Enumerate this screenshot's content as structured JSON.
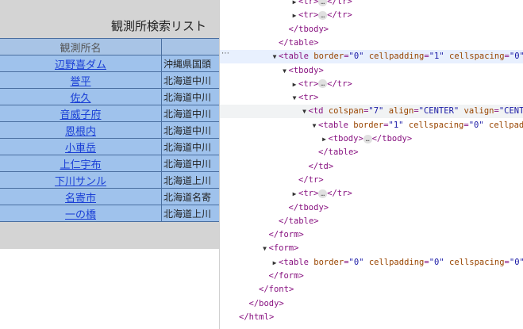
{
  "page": {
    "title": "観測所検索リスト",
    "table": {
      "header": [
        "観測所名",
        ""
      ],
      "rows": [
        {
          "name": "辺野喜ダム",
          "addr": "沖縄県国頭"
        },
        {
          "name": "誉平",
          "addr": "北海道中川"
        },
        {
          "name": "佐久",
          "addr": "北海道中川"
        },
        {
          "name": "音威子府",
          "addr": "北海道中川"
        },
        {
          "name": "恩根内",
          "addr": "北海道中川"
        },
        {
          "name": "小車岳",
          "addr": "北海道中川"
        },
        {
          "name": "上仁宇布",
          "addr": "北海道中川"
        },
        {
          "name": "下川サンル",
          "addr": "北海道上川"
        },
        {
          "name": "名寄市",
          "addr": "北海道名寄"
        },
        {
          "name": "一の橋",
          "addr": "北海道上川"
        }
      ]
    }
  },
  "devtools": {
    "more_icon": "⋯",
    "lines": [
      {
        "indent": 5,
        "toggle": "▶",
        "parts": [
          [
            "p",
            "<"
          ],
          [
            "t",
            "tr"
          ],
          [
            "p",
            ">"
          ],
          [
            "e",
            "…"
          ],
          [
            "p",
            "</"
          ],
          [
            "t",
            "tr"
          ],
          [
            "p",
            ">"
          ]
        ]
      },
      {
        "indent": 5,
        "toggle": "▶",
        "parts": [
          [
            "p",
            "<"
          ],
          [
            "t",
            "tr"
          ],
          [
            "p",
            ">"
          ],
          [
            "e",
            "…"
          ],
          [
            "p",
            "</"
          ],
          [
            "t",
            "tr"
          ],
          [
            "p",
            ">"
          ]
        ]
      },
      {
        "indent": 4,
        "toggle": "",
        "parts": [
          [
            "p",
            "</"
          ],
          [
            "t",
            "tbody"
          ],
          [
            "p",
            ">"
          ]
        ]
      },
      {
        "indent": 3,
        "toggle": "",
        "parts": [
          [
            "p",
            "</"
          ],
          [
            "t",
            "table"
          ],
          [
            "p",
            ">"
          ]
        ]
      },
      {
        "indent": 3,
        "toggle": "▼",
        "hl": true,
        "parts": [
          [
            "p",
            "<"
          ],
          [
            "t",
            "table"
          ],
          [
            "s",
            " "
          ],
          [
            "a",
            "border"
          ],
          [
            "p",
            "="
          ],
          [
            "v",
            "\"0\""
          ],
          [
            "s",
            " "
          ],
          [
            "a",
            "cellpadding"
          ],
          [
            "p",
            "="
          ],
          [
            "v",
            "\"1\""
          ],
          [
            "s",
            " "
          ],
          [
            "a",
            "cellspacing"
          ],
          [
            "p",
            "="
          ],
          [
            "v",
            "\"0\""
          ]
        ]
      },
      {
        "indent": 4,
        "toggle": "▼",
        "parts": [
          [
            "p",
            "<"
          ],
          [
            "t",
            "tbody"
          ],
          [
            "p",
            ">"
          ]
        ]
      },
      {
        "indent": 5,
        "toggle": "▶",
        "parts": [
          [
            "p",
            "<"
          ],
          [
            "t",
            "tr"
          ],
          [
            "p",
            ">"
          ],
          [
            "e",
            "…"
          ],
          [
            "p",
            "</"
          ],
          [
            "t",
            "tr"
          ],
          [
            "p",
            ">"
          ]
        ]
      },
      {
        "indent": 5,
        "toggle": "▼",
        "parts": [
          [
            "p",
            "<"
          ],
          [
            "t",
            "tr"
          ],
          [
            "p",
            ">"
          ]
        ]
      },
      {
        "indent": 6,
        "toggle": "▼",
        "hover": true,
        "parts": [
          [
            "p",
            "<"
          ],
          [
            "t",
            "td"
          ],
          [
            "s",
            " "
          ],
          [
            "a",
            "colspan"
          ],
          [
            "p",
            "="
          ],
          [
            "v",
            "\"7\""
          ],
          [
            "s",
            " "
          ],
          [
            "a",
            "align"
          ],
          [
            "p",
            "="
          ],
          [
            "v",
            "\"CENTER\""
          ],
          [
            "s",
            " "
          ],
          [
            "a",
            "valign"
          ],
          [
            "p",
            "="
          ],
          [
            "v",
            "\"CENTER\""
          ]
        ]
      },
      {
        "indent": 7,
        "toggle": "▼",
        "parts": [
          [
            "p",
            "<"
          ],
          [
            "t",
            "table"
          ],
          [
            "s",
            " "
          ],
          [
            "a",
            "border"
          ],
          [
            "p",
            "="
          ],
          [
            "v",
            "\"1\""
          ],
          [
            "s",
            " "
          ],
          [
            "a",
            "cellspacing"
          ],
          [
            "p",
            "="
          ],
          [
            "v",
            "\"0\""
          ],
          [
            "s",
            " "
          ],
          [
            "a",
            "cellpadding"
          ]
        ]
      },
      {
        "indent": 8,
        "toggle": "▶",
        "parts": [
          [
            "p",
            "<"
          ],
          [
            "t",
            "tbody"
          ],
          [
            "p",
            ">"
          ],
          [
            "e",
            "…"
          ],
          [
            "p",
            "</"
          ],
          [
            "t",
            "tbody"
          ],
          [
            "p",
            ">"
          ]
        ]
      },
      {
        "indent": 7,
        "toggle": "",
        "parts": [
          [
            "p",
            "</"
          ],
          [
            "t",
            "table"
          ],
          [
            "p",
            ">"
          ]
        ]
      },
      {
        "indent": 6,
        "toggle": "",
        "parts": [
          [
            "p",
            "</"
          ],
          [
            "t",
            "td"
          ],
          [
            "p",
            ">"
          ]
        ]
      },
      {
        "indent": 5,
        "toggle": "",
        "parts": [
          [
            "p",
            "</"
          ],
          [
            "t",
            "tr"
          ],
          [
            "p",
            ">"
          ]
        ]
      },
      {
        "indent": 5,
        "toggle": "▶",
        "parts": [
          [
            "p",
            "<"
          ],
          [
            "t",
            "tr"
          ],
          [
            "p",
            ">"
          ],
          [
            "e",
            "…"
          ],
          [
            "p",
            "</"
          ],
          [
            "t",
            "tr"
          ],
          [
            "p",
            ">"
          ]
        ]
      },
      {
        "indent": 4,
        "toggle": "",
        "parts": [
          [
            "p",
            "</"
          ],
          [
            "t",
            "tbody"
          ],
          [
            "p",
            ">"
          ]
        ]
      },
      {
        "indent": 3,
        "toggle": "",
        "parts": [
          [
            "p",
            "</"
          ],
          [
            "t",
            "table"
          ],
          [
            "p",
            ">"
          ]
        ]
      },
      {
        "indent": 2,
        "toggle": "",
        "parts": [
          [
            "p",
            "</"
          ],
          [
            "t",
            "form"
          ],
          [
            "p",
            ">"
          ]
        ]
      },
      {
        "indent": 2,
        "toggle": "▼",
        "parts": [
          [
            "p",
            "<"
          ],
          [
            "t",
            "form"
          ],
          [
            "p",
            ">"
          ]
        ]
      },
      {
        "indent": 3,
        "toggle": "▶",
        "parts": [
          [
            "p",
            "<"
          ],
          [
            "t",
            "table"
          ],
          [
            "s",
            " "
          ],
          [
            "a",
            "border"
          ],
          [
            "p",
            "="
          ],
          [
            "v",
            "\"0\""
          ],
          [
            "s",
            " "
          ],
          [
            "a",
            "cellpadding"
          ],
          [
            "p",
            "="
          ],
          [
            "v",
            "\"0\""
          ],
          [
            "s",
            " "
          ],
          [
            "a",
            "cellspacing"
          ],
          [
            "p",
            "="
          ],
          [
            "v",
            "\"0\""
          ]
        ]
      },
      {
        "indent": 2,
        "toggle": "",
        "parts": [
          [
            "p",
            "</"
          ],
          [
            "t",
            "form"
          ],
          [
            "p",
            ">"
          ]
        ]
      },
      {
        "indent": 1,
        "toggle": "",
        "parts": [
          [
            "p",
            "</"
          ],
          [
            "t",
            "font"
          ],
          [
            "p",
            ">"
          ]
        ]
      },
      {
        "indent": 0,
        "toggle": "",
        "parts": [
          [
            "p",
            "</"
          ],
          [
            "t",
            "body"
          ],
          [
            "p",
            ">"
          ]
        ]
      },
      {
        "indent": -1,
        "toggle": "",
        "parts": [
          [
            "p",
            "</"
          ],
          [
            "t",
            "html"
          ],
          [
            "p",
            ">"
          ]
        ]
      }
    ]
  }
}
